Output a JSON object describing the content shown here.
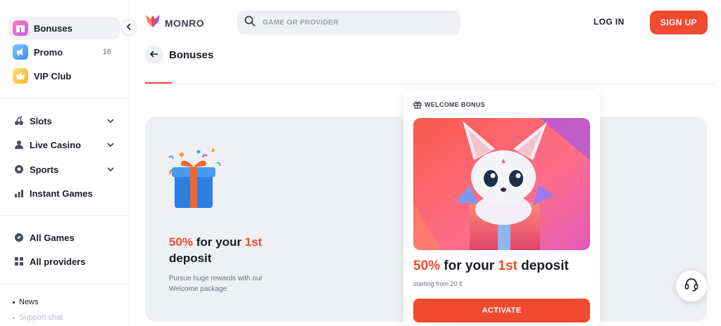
{
  "sidebar": {
    "top_items": [
      {
        "label": "Bonuses",
        "icon": "bonus-gift-icon",
        "active": true
      },
      {
        "label": "Promo",
        "icon": "promo-megaphone-icon",
        "count": "16"
      },
      {
        "label": "VIP Club",
        "icon": "crown-icon"
      }
    ],
    "category_items": [
      {
        "label": "Slots",
        "icon": "cherries-icon"
      },
      {
        "label": "Live Casino",
        "icon": "dealer-icon"
      },
      {
        "label": "Sports",
        "icon": "soccer-ball-icon"
      },
      {
        "label": "Instant Games",
        "icon": "bar-chart-icon"
      }
    ],
    "game_items": [
      {
        "label": "All Games",
        "icon": "compass-icon"
      },
      {
        "label": "All providers",
        "icon": "grid-icon"
      }
    ],
    "links": [
      "News",
      "Support chat"
    ]
  },
  "header": {
    "logo_text": "MONRO",
    "search_placeholder": "GAME OR PROVIDER",
    "login_label": "LOG IN",
    "signup_label": "SIGN UP"
  },
  "page": {
    "title": "Bonuses"
  },
  "banner": {
    "title_pct": "50%",
    "title_mid": " for your ",
    "title_ord": "1st",
    "title_end": " deposit",
    "description": "Pursue huge rewards with our Welcome package"
  },
  "card": {
    "label": "WELCOME BONUS",
    "title_pct": "50%",
    "title_mid": " for your ",
    "title_ord": "1st",
    "title_end": " deposit",
    "subtitle": "starting from 20 €",
    "button_label": "ACTIVATE"
  },
  "colors": {
    "accent": "#f04a30",
    "banner_bg": "#eef0f3"
  }
}
